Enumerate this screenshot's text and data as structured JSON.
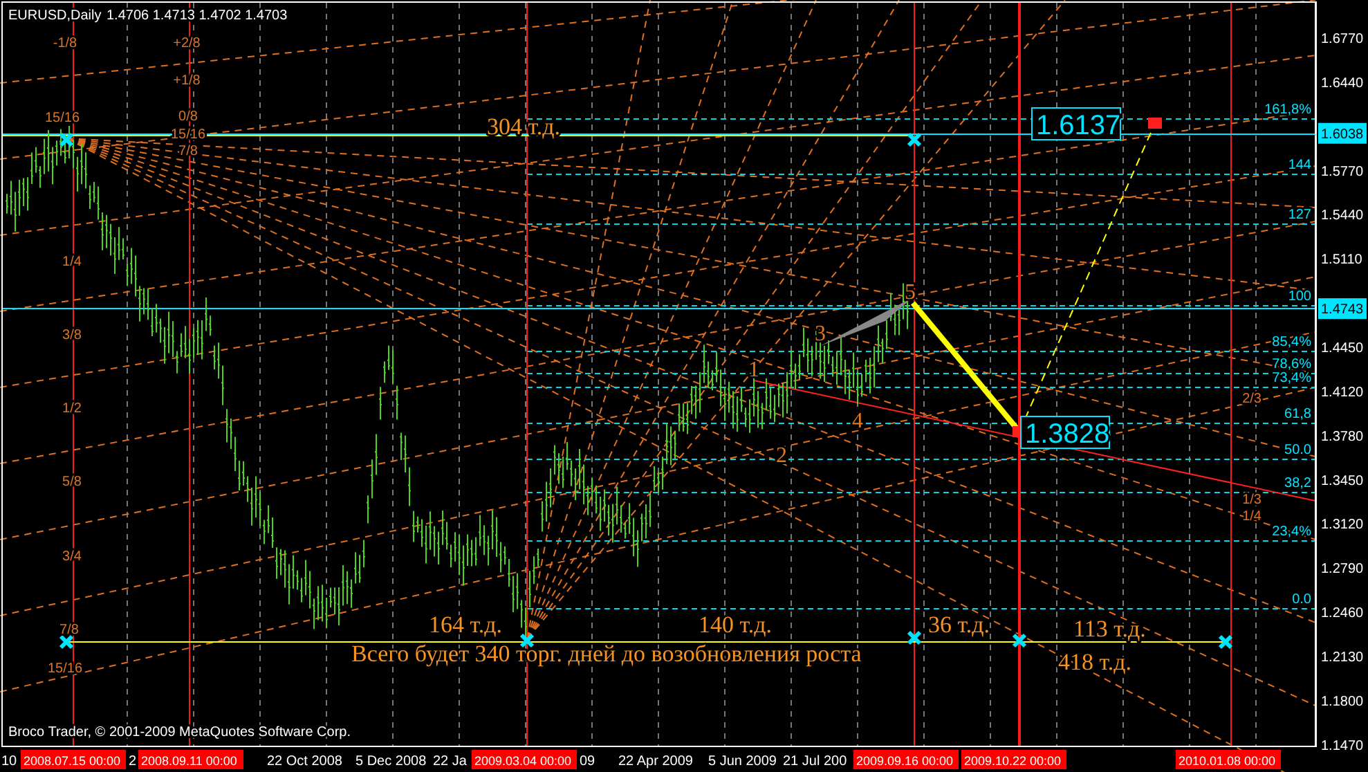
{
  "header": {
    "symbol": "EURUSD,Daily",
    "quotes": "1.4706 1.4713 1.4702 1.4703"
  },
  "price_scale": [
    "1.6770",
    "1.6440",
    {
      "marker": "1.6038"
    },
    "1.5770",
    "1.5440",
    "1.5110",
    {
      "marker": "1.4743"
    },
    "1.4450",
    "1.4120",
    "1.3780",
    "1.3450",
    "1.3120",
    "1.2790",
    "1.2460",
    "1.2130",
    "1.1800",
    "1.1470"
  ],
  "date_axis": [
    {
      "kind": "date",
      "label": "10"
    },
    {
      "kind": "marker",
      "label": "2008.07.15 00:00"
    },
    {
      "kind": "date",
      "label": "2"
    },
    {
      "kind": "marker",
      "label": "2008.09.11 00:00"
    },
    {
      "kind": "date",
      "label": "22 Oct 2008"
    },
    {
      "kind": "date",
      "label": "5 Dec 2008"
    },
    {
      "kind": "date",
      "label": "22 Ja"
    },
    {
      "kind": "marker",
      "label": "2009.03.04 00:00"
    },
    {
      "kind": "date",
      "label": "09"
    },
    {
      "kind": "date",
      "label": "22 Apr 2009"
    },
    {
      "kind": "date",
      "label": "5 Jun 2009"
    },
    {
      "kind": "date",
      "label": "21 Jul 200"
    },
    {
      "kind": "marker",
      "label": "2009.09.16 00:00"
    },
    {
      "kind": "marker",
      "label": "2009.10.22 00:00"
    },
    {
      "kind": "marker",
      "label": "2010.01.08 00:00"
    }
  ],
  "copyright": "Broco Trader, © 2001-2009 MetaQuotes Software Corp.",
  "fib_levels": [
    "161,8%",
    "144",
    "127",
    "100",
    "85,4%",
    "78,6%",
    "73,4%",
    "61,8",
    "50.0",
    "38,2",
    "23,4%",
    "0.0"
  ],
  "grid_levels": [
    "2/3",
    "1/3",
    "1/4"
  ],
  "murrey_labels": [
    "-1/8",
    "+2/8",
    "+1/8",
    "15/16",
    "0/8",
    "15/16",
    "7/8",
    "1/4",
    "3/8",
    "1/2",
    "5/8",
    "3/4",
    "7/8",
    "15/16"
  ],
  "wave_labels": [
    "1",
    "2",
    "3",
    "4",
    "5"
  ],
  "price_boxes": [
    "1.6137",
    "1.3828"
  ],
  "duration_labels": [
    "304 т.д.",
    "164 т.д.",
    "140 т.д.",
    "36 т.д.",
    "113 т.д.",
    "418 т.д."
  ],
  "summary": "Всего будет 340 торг. дней до возобновления роста"
}
